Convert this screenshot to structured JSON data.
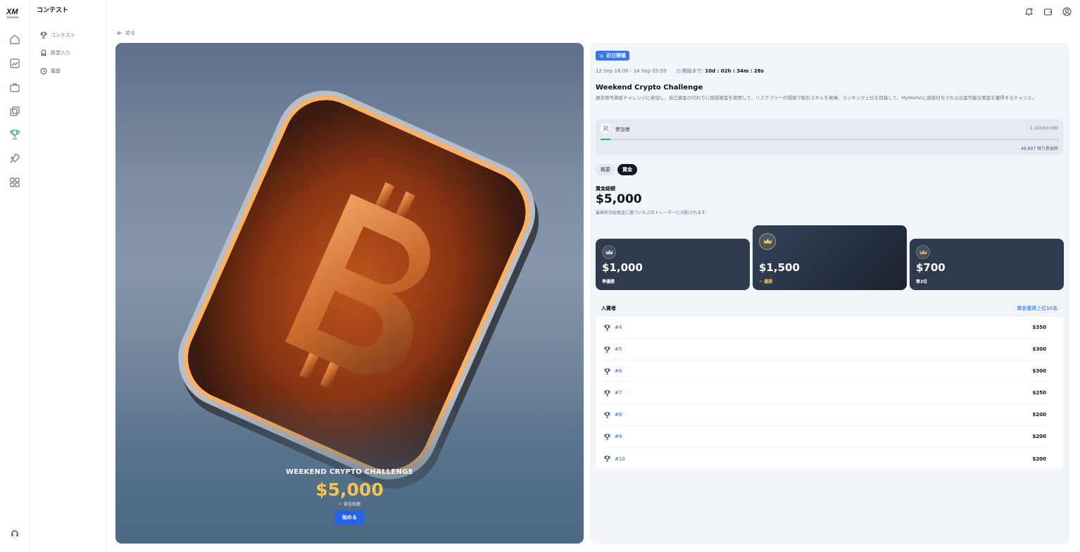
{
  "brand": {
    "logo_text": "XM",
    "logo_sub": "TRADING"
  },
  "sidebar": {
    "title": "コンテスト",
    "items": [
      {
        "label": "コンテスト",
        "icon": "trophy-icon"
      },
      {
        "label": "殿堂入り",
        "icon": "medal-icon"
      },
      {
        "label": "履歴",
        "icon": "history-icon"
      }
    ]
  },
  "rail_icons": [
    "home-icon",
    "chart-icon",
    "briefcase-icon",
    "copy-icon",
    "trophy-icon",
    "rocket-icon",
    "apps-icon",
    "support-icon"
  ],
  "header_icons": [
    "bell-icon",
    "wallet-icon",
    "user-icon"
  ],
  "back_label": "戻る",
  "hero": {
    "name": "WEEKEND CRYPTO CHALLENGE",
    "amount": "$5,000",
    "sub": "賞金総額",
    "button": "始める"
  },
  "contest": {
    "badge": "近日開催",
    "dates": "12 Sep 16:00 - 14 Sep 05:59",
    "countdown_label": "開始まで:",
    "countdown": "10d : 02h : 34m : 28s",
    "title": "Weekend Crypto Challenge",
    "description": "週末限号資産チャレンジに参加し、自己資金の代わりに仮想資金を使用して、リスクフリーの環境で取引スキルを発揮。ランキング上位を目指して、MyWalletに直接付与される出金可能な賞金を獲得するチャンス。",
    "participants_label": "参加者",
    "participants_count": "1,103/50,000",
    "participants_fraction": 0.022,
    "remaining": "48,897 残り参加枠"
  },
  "tabs": [
    {
      "label": "概要",
      "active": false
    },
    {
      "label": "賞金",
      "active": true
    }
  ],
  "prizes": {
    "pool_label": "賞金総額",
    "pool_amount": "$5,000",
    "pool_note": "最高有効証拠金に基づいた上位トレーダーに分配されます。",
    "top": [
      {
        "amount": "$1,000",
        "rank": "準優勝",
        "crown_color": "#cbd5e1"
      },
      {
        "amount": "$1,500",
        "rank": "優勝",
        "crown_color": "#f5c451"
      },
      {
        "amount": "$700",
        "rank": "第3位",
        "crown_color": "#d4a24c"
      }
    ],
    "list_title": "入賞者",
    "list_link": "賞金獲得上位10名",
    "rows": [
      {
        "rank": "#4",
        "prize": "$350"
      },
      {
        "rank": "#5",
        "prize": "$300"
      },
      {
        "rank": "#6",
        "prize": "$300"
      },
      {
        "rank": "#7",
        "prize": "$250"
      },
      {
        "rank": "#8",
        "prize": "$200"
      },
      {
        "rank": "#9",
        "prize": "$200"
      },
      {
        "rank": "#10",
        "prize": "$200"
      }
    ]
  }
}
